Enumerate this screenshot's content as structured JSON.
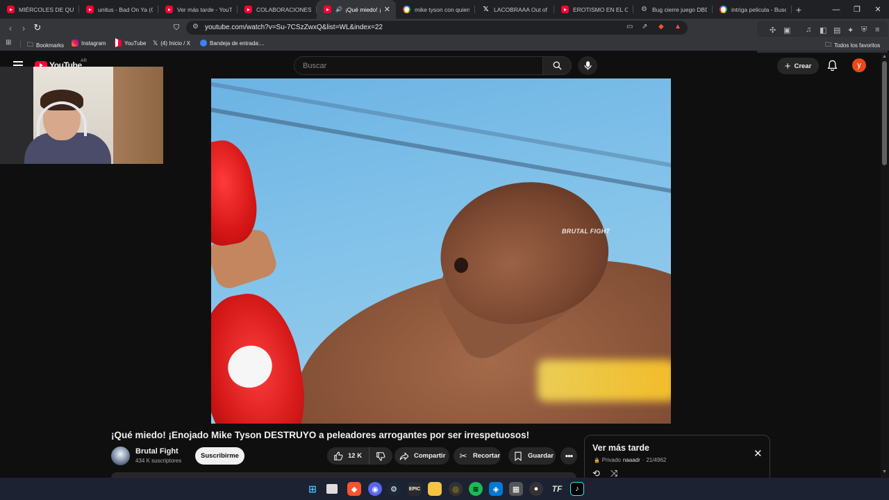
{
  "browser": {
    "tabs": [
      {
        "title": "MIÉRCOLES DE QUEJA",
        "icon": "youtube-icon"
      },
      {
        "title": "unitus - Bad On Ya (Of",
        "icon": "youtube-icon"
      },
      {
        "title": "Ver más tarde - YouTu",
        "icon": "youtube-icon"
      },
      {
        "title": "COLABORACIONES QU",
        "icon": "youtube-icon"
      },
      {
        "title": "¡Qué miedo! ¡E",
        "icon": "youtube-icon",
        "active": true,
        "audio": "🔊"
      },
      {
        "title": "mike tyson con quien p",
        "icon": "google-icon"
      },
      {
        "title": "LACOBRAAA Out of Co",
        "icon": "x-icon"
      },
      {
        "title": "EROTISMO EN EL CINE",
        "icon": "youtube-icon"
      },
      {
        "title": "Bug cierre juego DBD",
        "icon": "gear-icon"
      },
      {
        "title": "intriga pelicula - Busca",
        "icon": "google-icon"
      }
    ],
    "tab_close": "✕",
    "new_tab": "+",
    "url": "youtube.com/watch?v=Su-7CSzZwxQ&list=WL&index=22",
    "bookmarks": [
      {
        "label": "Bookmarks",
        "icon": "folder-icon"
      },
      {
        "label": "Instagram",
        "icon": "instagram-icon"
      },
      {
        "label": "YouTube",
        "icon": "youtube-icon"
      },
      {
        "label": "(4) Inicio / X",
        "icon": "x-icon"
      },
      {
        "label": "Bandeja de entrada:...",
        "icon": "mail-icon"
      }
    ],
    "all_bookmarks": "Todos los favoritos"
  },
  "youtube": {
    "logo_text": "YouTube",
    "country": "AR",
    "search_placeholder": "Buscar",
    "create_label": "Crear",
    "avatar_letter": "y",
    "watermark": "BRUTAL FIGHT",
    "video": {
      "title": "¡Qué miedo! ¡Enojado Mike Tyson DESTRUYO a peleadores arrogantes por ser irrespetuosos!",
      "channel": "Brutal Fight",
      "subscribers": "434 K suscriptores",
      "subscribe_label": "Suscribirme",
      "likes": "12 K",
      "share_label": "Compartir",
      "clip_label": "Recortar",
      "save_label": "Guardar",
      "more_label": "•••"
    },
    "playlist": {
      "title": "Ver más tarde",
      "privacy": "Privado",
      "owner": "naaadr",
      "separator": "·",
      "position": "21/4962"
    }
  },
  "colors": {
    "yt_red": "#ff0033",
    "bg": "#0f0f0f",
    "pill": "#272727"
  }
}
